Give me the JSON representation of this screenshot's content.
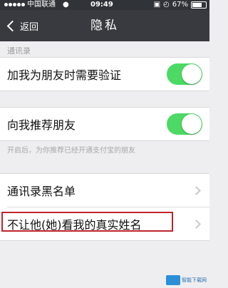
{
  "status_bar": {
    "carrier": "中国联通",
    "wifi_icon": "wifi-icon",
    "time": "09:49",
    "battery": "67%"
  },
  "nav": {
    "back_label": "返回",
    "title": "隐私"
  },
  "contacts_section": {
    "header": "通讯录",
    "rows": [
      {
        "label": "加我为朋友时需要验证",
        "toggle_on": true
      },
      {
        "label": "向我推荐朋友",
        "toggle_on": true
      }
    ],
    "footnote": "开启后，为你推荐已经开通支付宝的朋友"
  },
  "list_section": {
    "rows": [
      {
        "label": "通讯录黑名单"
      },
      {
        "label": "不让他(她)看我的真实姓名"
      }
    ]
  },
  "watermark": {
    "text": "智能下载网"
  },
  "colors": {
    "toggle_on": "#4cd964",
    "nav_bg": "#393a3f",
    "highlight": "#c0252b"
  }
}
